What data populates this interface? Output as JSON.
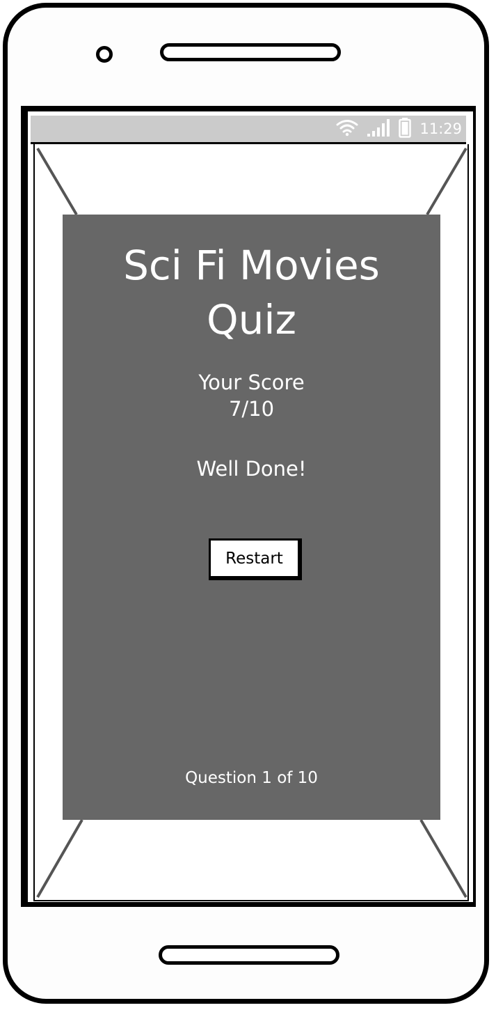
{
  "status_bar": {
    "time": "11:29",
    "icons": [
      "wifi-icon",
      "signal-icon",
      "battery-icon"
    ]
  },
  "quiz": {
    "title": "Sci Fi Movies\nQuiz",
    "score_label": "Your Score",
    "score_value": "7/10",
    "feedback": "Well Done!",
    "restart_label": "Restart",
    "progress": "Question 1 of 10"
  },
  "colors": {
    "modal_background": "#676767",
    "status_bar_background": "#cbcbcb",
    "text_on_modal": "#ffffff"
  }
}
